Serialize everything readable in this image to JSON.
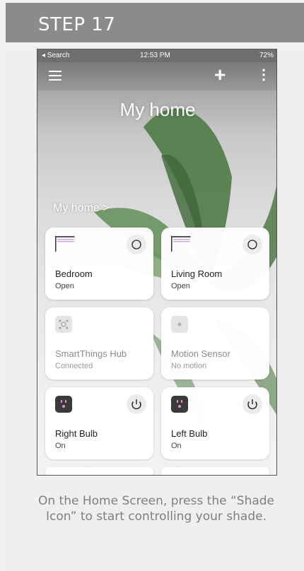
{
  "header": {
    "title": "STEP 17"
  },
  "phone": {
    "status_bar": {
      "left": "◂ Search",
      "time": "12:53 PM",
      "battery": "72%"
    },
    "top_bar": {
      "add_icon": "plus-icon",
      "more_icon": "more-vertical-icon",
      "menu_icon": "hamburger-menu-icon"
    },
    "home_title": "My home",
    "breadcrumb": "My home >",
    "tiles": [
      {
        "name": "Bedroom",
        "status": "Open",
        "icon": "shade-icon",
        "action": "circle-button-icon"
      },
      {
        "name": "Living Room",
        "status": "Open",
        "icon": "shade-icon",
        "action": "circle-button-icon"
      },
      {
        "name": "SmartThings Hub",
        "status": "Connected",
        "icon": "hub-icon"
      },
      {
        "name": "Motion Sensor",
        "status": "No motion",
        "icon": "motion-sensor-icon"
      },
      {
        "name": "Right Bulb",
        "status": "On",
        "icon": "plug-icon",
        "action": "power-icon"
      },
      {
        "name": "Left Bulb",
        "status": "On",
        "icon": "plug-icon",
        "action": "power-icon"
      }
    ]
  },
  "caption": {
    "line1": "On the Home Screen, press the “Shade",
    "line2": "Icon” to start controlling your shade."
  },
  "colors": {
    "header_bg": "#8b8b8b",
    "shade_accent": "#c9a9e6",
    "plug_bg": "#3a3a3a",
    "plug_accent": "#e48ad0"
  }
}
